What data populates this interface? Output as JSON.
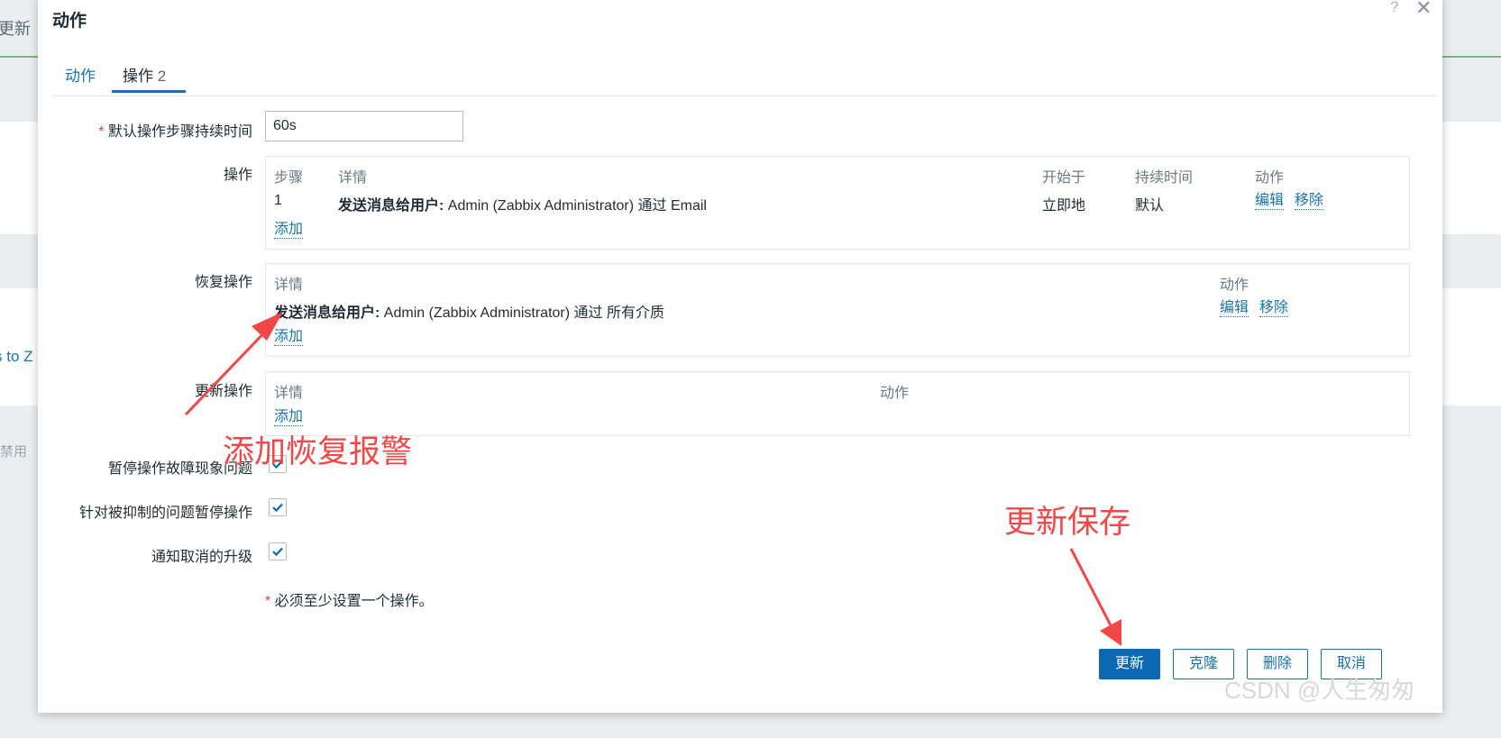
{
  "background": {
    "left_update_label": "更新",
    "left_link_fragment": "s to Z",
    "left_disable_label": "禁用"
  },
  "dialog": {
    "title": "动作",
    "help_glyph": "?",
    "close_glyph": "✕",
    "tabs": [
      {
        "label": "动作",
        "count": ""
      },
      {
        "label": "操作",
        "count": "2"
      }
    ],
    "default_duration": {
      "label": "默认操作步骤持续时间",
      "required_mark": "*",
      "value": "60s"
    },
    "operations": {
      "label": "操作",
      "headers": [
        "步骤",
        "详情",
        "开始于",
        "持续时间",
        "动作"
      ],
      "rows": [
        {
          "step": "1",
          "detail_bold": "发送消息给用户:",
          "detail_rest": " Admin (Zabbix Administrator) 通过 Email",
          "start": "立即地",
          "duration": "默认",
          "edit": "编辑",
          "remove": "移除"
        }
      ],
      "add_label": "添加"
    },
    "recovery_operations": {
      "label": "恢复操作",
      "headers": [
        "详情",
        "动作"
      ],
      "rows": [
        {
          "detail_bold": "发送消息给用户:",
          "detail_rest": " Admin (Zabbix Administrator) 通过 所有介质",
          "edit": "编辑",
          "remove": "移除"
        }
      ],
      "add_label": "添加"
    },
    "update_operations": {
      "label": "更新操作",
      "headers": [
        "详情",
        "动作"
      ],
      "add_label": "添加"
    },
    "checkboxes": [
      {
        "label": "暂停操作故障现象问题",
        "checked": true
      },
      {
        "label": "针对被抑制的问题暂停操作",
        "checked": true
      },
      {
        "label": "通知取消的升级",
        "checked": true
      }
    ],
    "note": {
      "mark": "*",
      "text": " 必须至少设置一个操作。"
    },
    "buttons": {
      "update": "更新",
      "clone": "克隆",
      "delete": "删除",
      "cancel": "取消"
    }
  },
  "annotations": {
    "recovery": "添加恢复报警",
    "save": "更新保存",
    "color": "#f04848"
  },
  "watermark": "CSDN @人生匆匆",
  "colors": {
    "accent": "#1a73a8",
    "primary_button": "#0c68b0",
    "required": "#d64545"
  }
}
